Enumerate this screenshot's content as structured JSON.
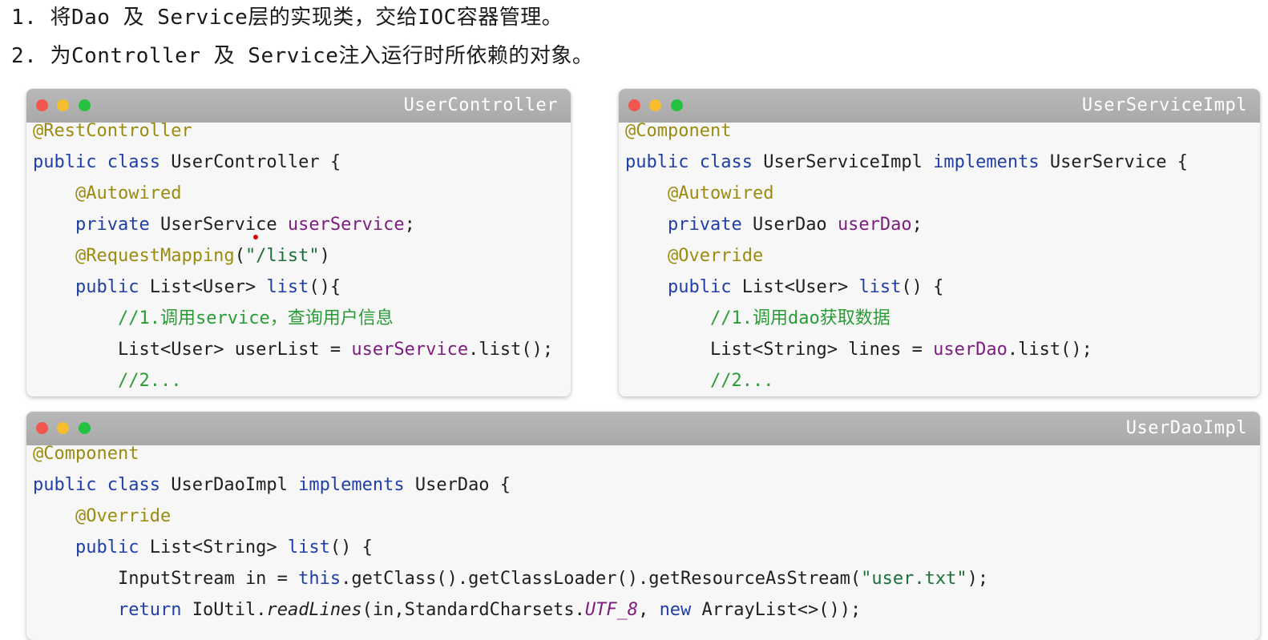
{
  "notes": {
    "line1": "1. 将Dao 及 Service层的实现类，交给IOC容器管理。",
    "line2": "2. 为Controller 及 Service注入运行时所依赖的对象。"
  },
  "colors": {
    "annotation": "#9b8b10",
    "keyword": "#1f3fa6",
    "field": "#7d1d7f",
    "string": "#1d6f3a",
    "comment": "#2a9c36",
    "titlebar": "#b0b0b0",
    "dot_red": "#f2564e",
    "dot_yellow": "#f6bd2e",
    "dot_green": "#25c23f"
  },
  "windows": {
    "controller": {
      "title": "UserController",
      "code": {
        "l1_ann": "@RestController",
        "l2_kw": "public class",
        "l2_rest": " UserController {",
        "l3_ann": "@Autowired",
        "l4_kw": "private",
        "l4_type": " UserService ",
        "l4_field": "userService",
        "l4_end": ";",
        "l5_ann": "@RequestMapping",
        "l5_paren_open": "(",
        "l5_str": "\"/list\"",
        "l5_paren_close": ")",
        "l6_kw": "public",
        "l6_type": " List<User> ",
        "l6_method": "list",
        "l6_end": "(){",
        "l7_cmt": "//1.调用service，查询用户信息",
        "l8_type": "List<User> userList = ",
        "l8_field": "userService",
        "l8_end": ".list();",
        "l9_cmt": "//2..."
      }
    },
    "service": {
      "title": "UserServiceImpl",
      "code": {
        "l1_ann": "@Component",
        "l2_kw": "public class",
        "l2_name": " UserServiceImpl ",
        "l2_kw2": "implements",
        "l2_rest": " UserService {",
        "l3_ann": "@Autowired",
        "l4_kw": "private",
        "l4_type": " UserDao ",
        "l4_field": "userDao",
        "l4_end": ";",
        "l5_ann": "@Override",
        "l6_kw": "public",
        "l6_type": " List<User> ",
        "l6_method": "list",
        "l6_end": "() {",
        "l7_cmt": "//1.调用dao获取数据",
        "l8_type": "List<String> lines = ",
        "l8_field": "userDao",
        "l8_end": ".list();",
        "l9_cmt": "//2..."
      }
    },
    "dao": {
      "title": "UserDaoImpl",
      "code": {
        "l1_ann": "@Component",
        "l2_kw": "public class",
        "l2_name": " UserDaoImpl ",
        "l2_kw2": "implements",
        "l2_rest": " UserDao {",
        "l3_ann": "@Override",
        "l4_kw": "public",
        "l4_type": " List<String> ",
        "l4_method": "list",
        "l4_end": "() {",
        "l5_type": "InputStream in = ",
        "l5_kw": "this",
        "l5_mid": ".getClass().getClassLoader().getResourceAsStream(",
        "l5_str": "\"user.txt\"",
        "l5_end": ");",
        "l6_kw": "return",
        "l6_type": " IoUtil.",
        "l6_method": "readLines",
        "l6_mid": "(in,StandardCharsets.",
        "l6_const": "UTF_8",
        "l6_comma": ", ",
        "l6_kw2": "new",
        "l6_end": " ArrayList<>());"
      }
    }
  }
}
